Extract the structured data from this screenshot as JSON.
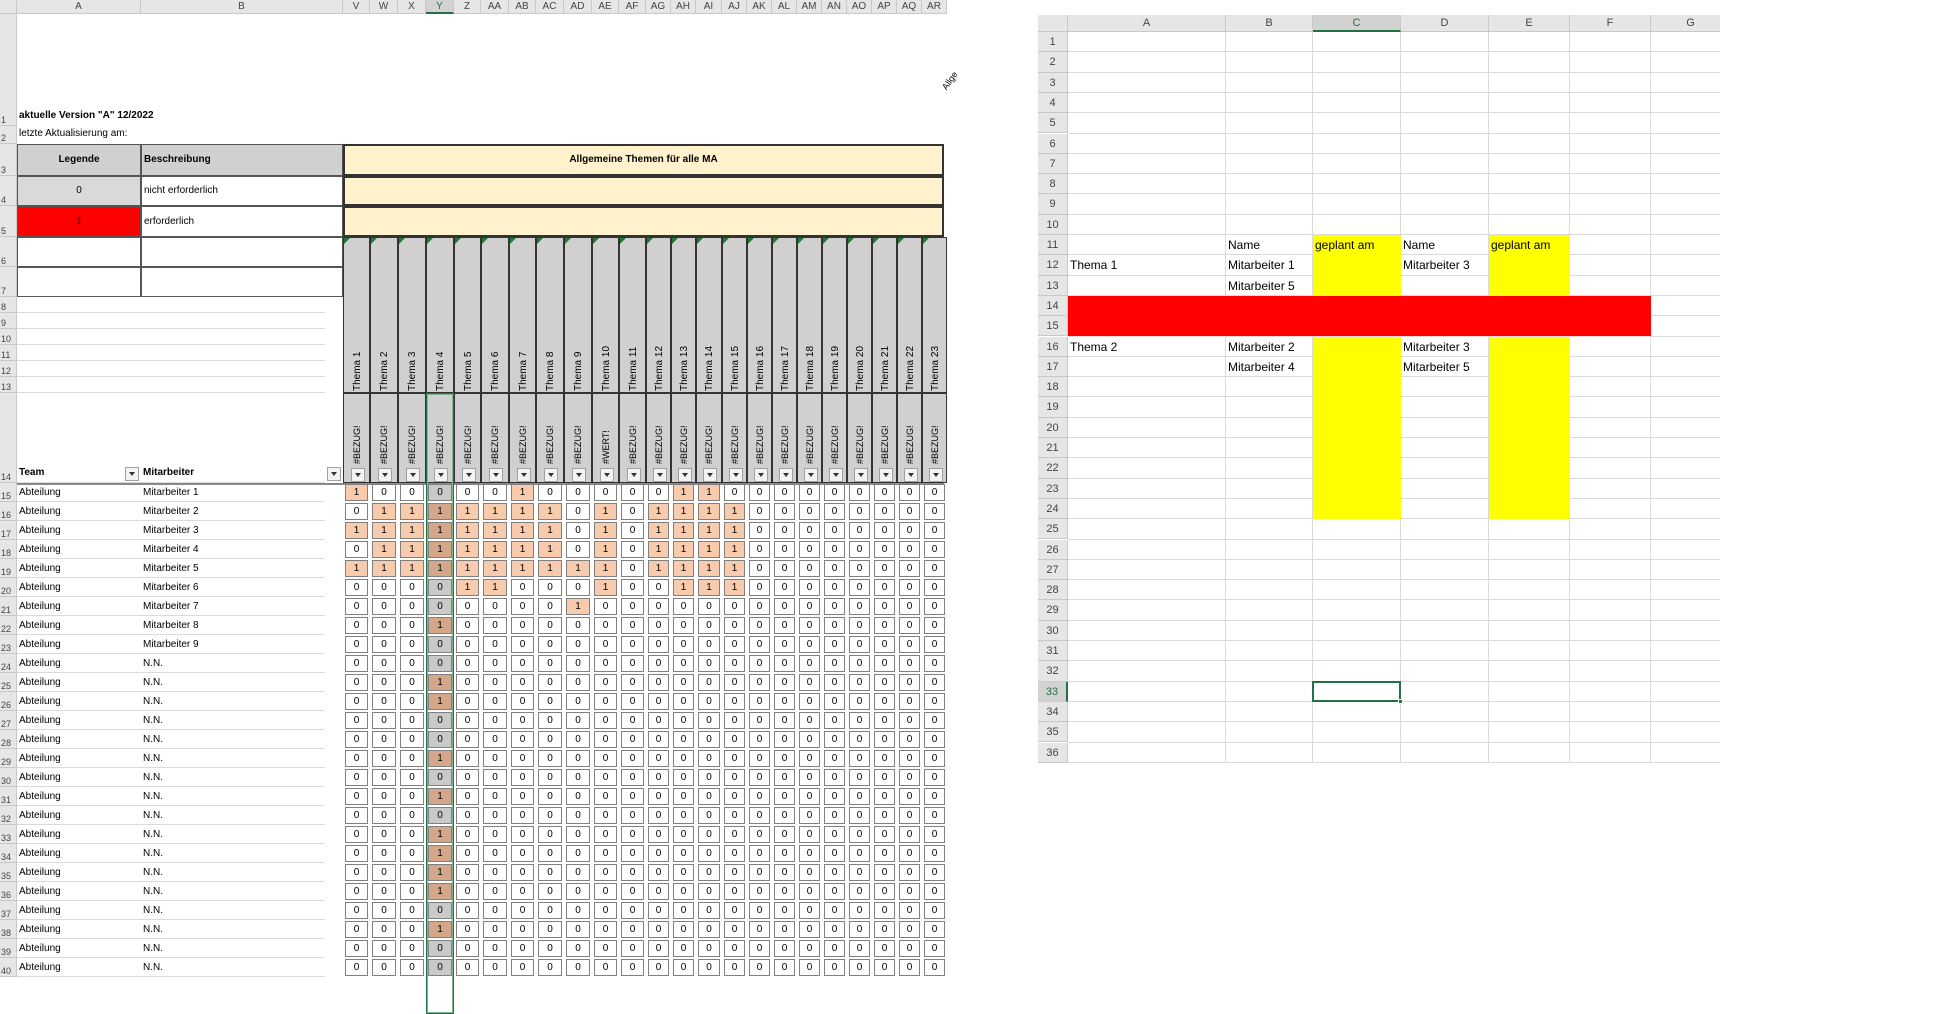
{
  "sheet1": {
    "col_headers": [
      {
        "label": "A",
        "w": 124
      },
      {
        "label": "B",
        "w": 202
      },
      {
        "label": "V",
        "w": 27
      },
      {
        "label": "W",
        "w": 28
      },
      {
        "label": "X",
        "w": 28
      },
      {
        "label": "Y",
        "w": 28
      },
      {
        "label": "Z",
        "w": 27
      },
      {
        "label": "AA",
        "w": 28
      },
      {
        "label": "AB",
        "w": 27
      },
      {
        "label": "AC",
        "w": 28
      },
      {
        "label": "AD",
        "w": 28
      },
      {
        "label": "AE",
        "w": 27
      },
      {
        "label": "AF",
        "w": 27
      },
      {
        "label": "AG",
        "w": 25
      },
      {
        "label": "AH",
        "w": 25
      },
      {
        "label": "AI",
        "w": 26
      },
      {
        "label": "AJ",
        "w": 25
      },
      {
        "label": "AK",
        "w": 25
      },
      {
        "label": "AL",
        "w": 25
      },
      {
        "label": "AM",
        "w": 25
      },
      {
        "label": "AN",
        "w": 25
      },
      {
        "label": "AO",
        "w": 25
      },
      {
        "label": "AP",
        "w": 25
      },
      {
        "label": "AQ",
        "w": 25
      },
      {
        "label": "AR",
        "w": 25
      }
    ],
    "selected_col": "Y",
    "version_text": "aktuelle Version \"A\" 12/2022",
    "update_text": "letzte Aktualisierung am:",
    "legend_header": "Legende",
    "description_header": "Beschreibung",
    "legend_rows": [
      {
        "value": "0",
        "desc": "nicht erforderlich",
        "color": "#d9d9d9"
      },
      {
        "value": "1",
        "desc": "erforderlich",
        "color": "#ff0000"
      }
    ],
    "general_topics_title": "Allgemeine Themen für alle MA",
    "topic_bar_color": "#fff2cc",
    "overflow_label": "Allge",
    "themes": [
      "Thema 1",
      "Thema 2",
      "Thema 3",
      "Thema 4",
      "Thema 5",
      "Thema 6",
      "Thema 7",
      "Thema 8",
      "Thema 9",
      "Thema 10",
      "Thema 11",
      "Thema 12",
      "Thema 13",
      "Thema 14",
      "Thema 15",
      "Thema 16",
      "Thema 17",
      "Thema 18",
      "Thema 19",
      "Thema 20",
      "Thema 21",
      "Thema 22",
      "Thema 23"
    ],
    "bezug_labels": [
      "#BEZUG!",
      "#BEZUG!",
      "#BEZUG!",
      "#BEZUG!",
      "#BEZUG!",
      "#BEZUG!",
      "#BEZUG!",
      "#BEZUG!",
      "#BEZUG!",
      "#WERT!",
      "#BEZUG!",
      "#BEZUG!",
      "#BEZUG!",
      "#BEZUG!",
      "#BEZUG!",
      "#BEZUG!",
      "#BEZUG!",
      "#BEZUG!",
      "#BEZUG!",
      "#BEZUG!",
      "#BEZUG!",
      "#BEZUG!",
      "#BEZUG!"
    ],
    "team_header": "Team",
    "employee_header": "Mitarbeiter",
    "colors": {
      "one": "#f8cbad",
      "zero": "#ffffff",
      "y_col_one": "#d4a78a",
      "y_col_zero": "#c9c9c9",
      "header_gray": "#d0d0d0"
    },
    "data_rows": [
      {
        "row": "15",
        "team": "Abteilung",
        "employee": "Mitarbeiter 1",
        "values": [
          1,
          0,
          0,
          0,
          0,
          0,
          1,
          0,
          0,
          0,
          0,
          0,
          1,
          1,
          0,
          0,
          0,
          0,
          0,
          0,
          0,
          0,
          0
        ]
      },
      {
        "row": "16",
        "team": "Abteilung",
        "employee": "Mitarbeiter 2",
        "values": [
          0,
          1,
          1,
          1,
          1,
          1,
          1,
          1,
          0,
          1,
          0,
          1,
          1,
          1,
          1,
          0,
          0,
          0,
          0,
          0,
          0,
          0,
          0
        ]
      },
      {
        "row": "17",
        "team": "Abteilung",
        "employee": "Mitarbeiter 3",
        "values": [
          1,
          1,
          1,
          1,
          1,
          1,
          1,
          1,
          0,
          1,
          0,
          1,
          1,
          1,
          1,
          0,
          0,
          0,
          0,
          0,
          0,
          0,
          0
        ]
      },
      {
        "row": "18",
        "team": "Abteilung",
        "employee": "Mitarbeiter 4",
        "values": [
          0,
          1,
          1,
          1,
          1,
          1,
          1,
          1,
          0,
          1,
          0,
          1,
          1,
          1,
          1,
          0,
          0,
          0,
          0,
          0,
          0,
          0,
          0
        ]
      },
      {
        "row": "19",
        "team": "Abteilung",
        "employee": "Mitarbeiter 5",
        "values": [
          1,
          1,
          1,
          1,
          1,
          1,
          1,
          1,
          1,
          1,
          0,
          1,
          1,
          1,
          1,
          0,
          0,
          0,
          0,
          0,
          0,
          0,
          0
        ]
      },
      {
        "row": "20",
        "team": "Abteilung",
        "employee": "Mitarbeiter 6",
        "values": [
          0,
          0,
          0,
          0,
          1,
          1,
          0,
          0,
          0,
          1,
          0,
          0,
          1,
          1,
          1,
          0,
          0,
          0,
          0,
          0,
          0,
          0,
          0
        ]
      },
      {
        "row": "21",
        "team": "Abteilung",
        "employee": "Mitarbeiter 7",
        "values": [
          0,
          0,
          0,
          0,
          0,
          0,
          0,
          0,
          1,
          0,
          0,
          0,
          0,
          0,
          0,
          0,
          0,
          0,
          0,
          0,
          0,
          0,
          0
        ]
      },
      {
        "row": "22",
        "team": "Abteilung",
        "employee": "Mitarbeiter 8",
        "values": [
          0,
          0,
          0,
          1,
          0,
          0,
          0,
          0,
          0,
          0,
          0,
          0,
          0,
          0,
          0,
          0,
          0,
          0,
          0,
          0,
          0,
          0,
          0
        ]
      },
      {
        "row": "23",
        "team": "Abteilung",
        "employee": "Mitarbeiter 9",
        "values": [
          0,
          0,
          0,
          0,
          0,
          0,
          0,
          0,
          0,
          0,
          0,
          0,
          0,
          0,
          0,
          0,
          0,
          0,
          0,
          0,
          0,
          0,
          0
        ]
      },
      {
        "row": "24",
        "team": "Abteilung",
        "employee": "N.N.",
        "values": [
          0,
          0,
          0,
          0,
          0,
          0,
          0,
          0,
          0,
          0,
          0,
          0,
          0,
          0,
          0,
          0,
          0,
          0,
          0,
          0,
          0,
          0,
          0
        ]
      },
      {
        "row": "25",
        "team": "Abteilung",
        "employee": "N.N.",
        "values": [
          0,
          0,
          0,
          1,
          0,
          0,
          0,
          0,
          0,
          0,
          0,
          0,
          0,
          0,
          0,
          0,
          0,
          0,
          0,
          0,
          0,
          0,
          0
        ]
      },
      {
        "row": "26",
        "team": "Abteilung",
        "employee": "N.N.",
        "values": [
          0,
          0,
          0,
          1,
          0,
          0,
          0,
          0,
          0,
          0,
          0,
          0,
          0,
          0,
          0,
          0,
          0,
          0,
          0,
          0,
          0,
          0,
          0
        ]
      },
      {
        "row": "27",
        "team": "Abteilung",
        "employee": "N.N.",
        "values": [
          0,
          0,
          0,
          0,
          0,
          0,
          0,
          0,
          0,
          0,
          0,
          0,
          0,
          0,
          0,
          0,
          0,
          0,
          0,
          0,
          0,
          0,
          0
        ]
      },
      {
        "row": "28",
        "team": "Abteilung",
        "employee": "N.N.",
        "values": [
          0,
          0,
          0,
          0,
          0,
          0,
          0,
          0,
          0,
          0,
          0,
          0,
          0,
          0,
          0,
          0,
          0,
          0,
          0,
          0,
          0,
          0,
          0
        ]
      },
      {
        "row": "29",
        "team": "Abteilung",
        "employee": "N.N.",
        "values": [
          0,
          0,
          0,
          1,
          0,
          0,
          0,
          0,
          0,
          0,
          0,
          0,
          0,
          0,
          0,
          0,
          0,
          0,
          0,
          0,
          0,
          0,
          0
        ]
      },
      {
        "row": "30",
        "team": "Abteilung",
        "employee": "N.N.",
        "values": [
          0,
          0,
          0,
          0,
          0,
          0,
          0,
          0,
          0,
          0,
          0,
          0,
          0,
          0,
          0,
          0,
          0,
          0,
          0,
          0,
          0,
          0,
          0
        ]
      },
      {
        "row": "31",
        "team": "Abteilung",
        "employee": "N.N.",
        "values": [
          0,
          0,
          0,
          1,
          0,
          0,
          0,
          0,
          0,
          0,
          0,
          0,
          0,
          0,
          0,
          0,
          0,
          0,
          0,
          0,
          0,
          0,
          0
        ]
      },
      {
        "row": "32",
        "team": "Abteilung",
        "employee": "N.N.",
        "values": [
          0,
          0,
          0,
          0,
          0,
          0,
          0,
          0,
          0,
          0,
          0,
          0,
          0,
          0,
          0,
          0,
          0,
          0,
          0,
          0,
          0,
          0,
          0
        ]
      },
      {
        "row": "33",
        "team": "Abteilung",
        "employee": "N.N.",
        "values": [
          0,
          0,
          0,
          1,
          0,
          0,
          0,
          0,
          0,
          0,
          0,
          0,
          0,
          0,
          0,
          0,
          0,
          0,
          0,
          0,
          0,
          0,
          0
        ]
      },
      {
        "row": "34",
        "team": "Abteilung",
        "employee": "N.N.",
        "values": [
          0,
          0,
          0,
          1,
          0,
          0,
          0,
          0,
          0,
          0,
          0,
          0,
          0,
          0,
          0,
          0,
          0,
          0,
          0,
          0,
          0,
          0,
          0
        ]
      },
      {
        "row": "35",
        "team": "Abteilung",
        "employee": "N.N.",
        "values": [
          0,
          0,
          0,
          1,
          0,
          0,
          0,
          0,
          0,
          0,
          0,
          0,
          0,
          0,
          0,
          0,
          0,
          0,
          0,
          0,
          0,
          0,
          0
        ]
      },
      {
        "row": "36",
        "team": "Abteilung",
        "employee": "N.N.",
        "values": [
          0,
          0,
          0,
          1,
          0,
          0,
          0,
          0,
          0,
          0,
          0,
          0,
          0,
          0,
          0,
          0,
          0,
          0,
          0,
          0,
          0,
          0,
          0
        ]
      },
      {
        "row": "37",
        "team": "Abteilung",
        "employee": "N.N.",
        "values": [
          0,
          0,
          0,
          0,
          0,
          0,
          0,
          0,
          0,
          0,
          0,
          0,
          0,
          0,
          0,
          0,
          0,
          0,
          0,
          0,
          0,
          0,
          0
        ]
      },
      {
        "row": "38",
        "team": "Abteilung",
        "employee": "N.N.",
        "values": [
          0,
          0,
          0,
          1,
          0,
          0,
          0,
          0,
          0,
          0,
          0,
          0,
          0,
          0,
          0,
          0,
          0,
          0,
          0,
          0,
          0,
          0,
          0
        ]
      },
      {
        "row": "39",
        "team": "Abteilung",
        "employee": "N.N.",
        "values": [
          0,
          0,
          0,
          0,
          0,
          0,
          0,
          0,
          0,
          0,
          0,
          0,
          0,
          0,
          0,
          0,
          0,
          0,
          0,
          0,
          0,
          0,
          0
        ]
      },
      {
        "row": "40",
        "team": "Abteilung",
        "employee": "N.N.",
        "values": [
          0,
          0,
          0,
          0,
          0,
          0,
          0,
          0,
          0,
          0,
          0,
          0,
          0,
          0,
          0,
          0,
          0,
          0,
          0,
          0,
          0,
          0,
          0
        ]
      }
    ]
  },
  "sheet2": {
    "col_headers": [
      "A",
      "B",
      "C",
      "D",
      "E",
      "F",
      "G"
    ],
    "selected_col": "C",
    "selected_row": "33",
    "row_count": 36,
    "colors": {
      "yellow": "#ffff00",
      "red": "#ff0000"
    },
    "cells": [
      {
        "ref": "B11",
        "text": "Name"
      },
      {
        "ref": "C11",
        "text": "geplant am"
      },
      {
        "ref": "D11",
        "text": "Name"
      },
      {
        "ref": "E11",
        "text": "geplant am"
      },
      {
        "ref": "A12",
        "text": "Thema 1"
      },
      {
        "ref": "B12",
        "text": "Mitarbeiter 1"
      },
      {
        "ref": "D12",
        "text": "Mitarbeiter 3"
      },
      {
        "ref": "B13",
        "text": "Mitarbeiter 5"
      },
      {
        "ref": "A16",
        "text": "Thema 2"
      },
      {
        "ref": "B16",
        "text": "Mitarbeiter 2"
      },
      {
        "ref": "D16",
        "text": "Mitarbeiter 3"
      },
      {
        "ref": "B17",
        "text": "Mitarbeiter 4"
      },
      {
        "ref": "D17",
        "text": "Mitarbeiter 5"
      }
    ]
  }
}
